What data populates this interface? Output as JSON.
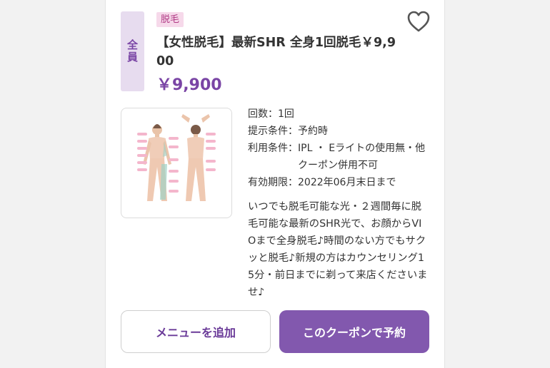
{
  "coupon": {
    "target_tag": "全員",
    "category": "脱毛",
    "title": "【女性脱毛】最新SHR 全身1回脱毛￥9,900",
    "price": "￥9,900",
    "details": [
      {
        "key": "回数：",
        "value": "1回"
      },
      {
        "key": "提示条件：",
        "value": "予約時"
      },
      {
        "key": "利用条件：",
        "value": "IPL ・ Eライトの使用無・他クーポン併用不可"
      },
      {
        "key": "有効期限：",
        "value": "2022年06月末日まで"
      }
    ],
    "description": "いつでも脱毛可能な光・２週間毎に脱毛可能な最新のSHR光で、お顔からVIOまで全身脱毛♪時間のない方でもサクッと脱毛♪新規の方はカウンセリング15分・前日までに剃って来店くださいませ♪"
  },
  "buttons": {
    "add_menu": "メニューを追加",
    "reserve": "このクーポンで予約"
  },
  "icons": {
    "favorite": "heart-outline-icon"
  },
  "colors": {
    "accent": "#7a45a5",
    "button_primary": "#8258ae",
    "tag_bg": "#e7dcef",
    "category_bg": "#f6d9ea"
  }
}
